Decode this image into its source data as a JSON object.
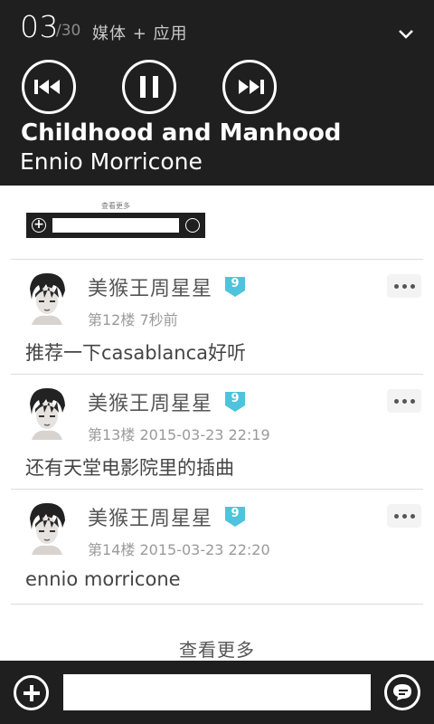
{
  "media": {
    "track_index": "03",
    "track_total": "/30",
    "title": "媒体 + 应用",
    "song_title": "Childhood and Manhood",
    "artist": "Ennio Morricone",
    "icons": [
      "chevron-down-icon",
      "previous-icon",
      "pause-icon",
      "next-icon"
    ]
  },
  "thumbnail": {
    "see_more": "查看更多"
  },
  "comments": [
    {
      "user": "美猴王周星星",
      "level": "9",
      "floor": "第12楼",
      "time": "7秒前",
      "text": "推荐一下casablanca好听"
    },
    {
      "user": "美猴王周星星",
      "level": "9",
      "floor": "第13楼",
      "time": "2015-03-23 22:19",
      "text": "还有天堂电影院里的插曲"
    },
    {
      "user": "美猴王周星星",
      "level": "9",
      "floor": "第14楼",
      "time": "2015-03-23 22:20",
      "text": "ennio morricone"
    }
  ],
  "see_more": "查看更多",
  "reply": {
    "input_value": "",
    "icons": [
      "add-icon",
      "send-comment-icon"
    ]
  },
  "colors": {
    "bar_background": "#1f1f1f",
    "level_badge": "#4dc4dc",
    "divider": "#dcdcdc"
  }
}
